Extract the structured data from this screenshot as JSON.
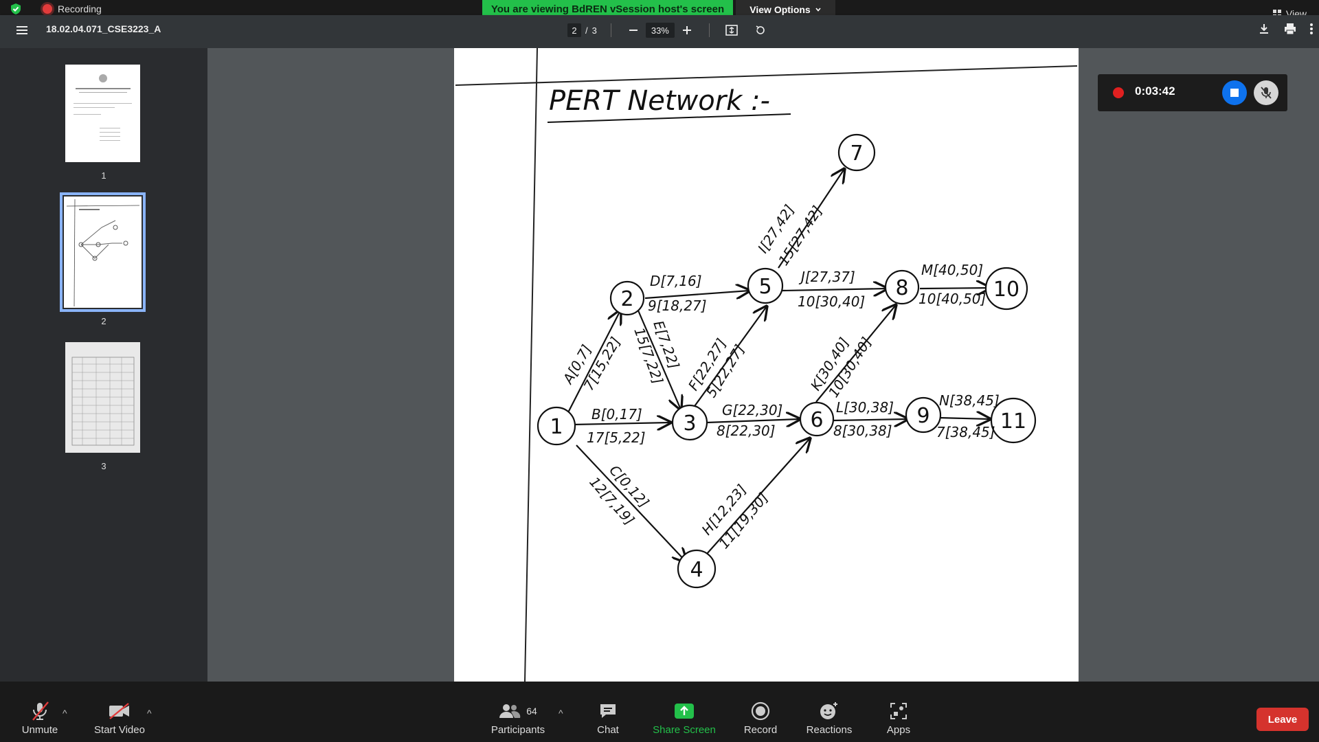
{
  "top": {
    "recording_label": "Recording",
    "viewing_banner": "You are viewing BdREN vSession host's screen",
    "view_options_label": "View Options",
    "view_label": "View"
  },
  "pdf": {
    "filename": "18.02.04.071_CSE3223_A",
    "current_page": "2",
    "page_sep": "/",
    "total_pages": "3",
    "zoom": "33%"
  },
  "thumbnails": [
    {
      "label": "1"
    },
    {
      "label": "2"
    },
    {
      "label": "3"
    }
  ],
  "document": {
    "heading": "PERT Network :-",
    "nodes": [
      "1",
      "2",
      "3",
      "4",
      "5",
      "6",
      "7",
      "8",
      "9",
      "10",
      "11"
    ],
    "edges": {
      "A1": "A[0,7]",
      "A2": "7[15,22]",
      "B1": "B[0,17]",
      "B2": "17[5,22]",
      "C1": "C[0,12]",
      "C2": "12[7,19]",
      "D1": "D[7,16]",
      "D2": "9[18,27]",
      "E1": "E[7,22]",
      "E2": "15[7,22]",
      "F1": "F[22,27]",
      "F2": "5[22,27]",
      "G1": "G[22,30]",
      "G2": "8[22,30]",
      "H1": "H[12,23]",
      "H2": "11[19,30]",
      "I1": "I[27,42]",
      "I2": "15[27,42]",
      "J1": "J[27,37]",
      "J2": "10[30,40]",
      "K1": "K[30,40]",
      "K2": "10[30,40]",
      "L1": "L[30,38]",
      "L2": "8[30,38]",
      "M1": "M[40,50]",
      "M2": "10[40,50]",
      "N1": "N[38,45]",
      "N2": "7[38,45]"
    }
  },
  "recording_widget": {
    "timer": "0:03:42"
  },
  "bottom": {
    "unmute": "Unmute",
    "start_video": "Start Video",
    "participants": "Participants",
    "participants_count": "64",
    "chat": "Chat",
    "share_screen": "Share Screen",
    "record": "Record",
    "reactions": "Reactions",
    "apps": "Apps",
    "leave": "Leave"
  },
  "colors": {
    "banner_green": "#23c04a",
    "share_green": "#23c04a",
    "leave_red": "#d5332d",
    "stop_blue": "#0e72ed",
    "selected_thumb": "#8ab4f8"
  }
}
